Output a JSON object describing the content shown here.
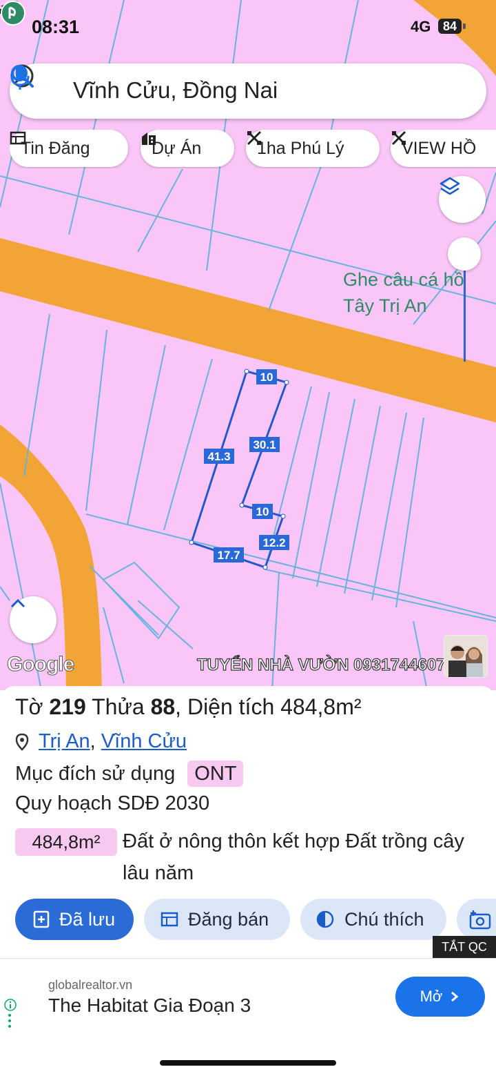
{
  "status_bar": {
    "time": "08:31",
    "network": "4G",
    "battery": "84"
  },
  "search": {
    "query": "Vĩnh Cửu, Đồng Nai"
  },
  "chips": [
    {
      "label": "Tin Đăng",
      "icon": "listing-icon"
    },
    {
      "label": "Dự Án",
      "icon": "building-icon"
    },
    {
      "label": "1ha Phú Lý",
      "icon": "tools-icon"
    },
    {
      "label": "VIEW HỒ",
      "icon": "tools-icon"
    }
  ],
  "map": {
    "poi": {
      "line1": "Ghe câu cá hồ",
      "line2": "Tây Trị An"
    },
    "measurements": [
      "10",
      "30.1",
      "41.3",
      "10",
      "12.2",
      "17.7"
    ],
    "attribution": "Google",
    "watermark": "TUYỂN NHÀ VƯỜN 0931744607",
    "colors": {
      "land": "#fac6f7",
      "road": "#f3a436",
      "parcel_line": "#66b4dc",
      "plot_outline": "#2358c8"
    }
  },
  "parcel": {
    "sheet_label": "Tờ",
    "sheet_no": "219",
    "plot_label": "Thửa",
    "plot_no": "88",
    "area_label": "Diện tích",
    "area": "484,8m²",
    "ward": "Trị An",
    "district": "Vĩnh Cửu",
    "usage_label": "Mục đích sử dụng",
    "usage_code": "ONT",
    "plan_label": "Quy hoạch SDĐ 2030",
    "plan_area": "484,8m²",
    "plan_desc": "Đất ở nông thôn kết hợp Đất trồng cây lâu năm"
  },
  "actions": [
    {
      "label": "Đã lưu",
      "icon": "bookmark-plus-icon"
    },
    {
      "label": "Đăng bán",
      "icon": "listing-icon"
    },
    {
      "label": "Chú thích",
      "icon": "contrast-icon"
    }
  ],
  "ad": {
    "close_label": "TẮT QC",
    "domain": "globalrealtor.vn",
    "title": "The Habitat Gia Đoạn 3",
    "cta": "Mở"
  }
}
